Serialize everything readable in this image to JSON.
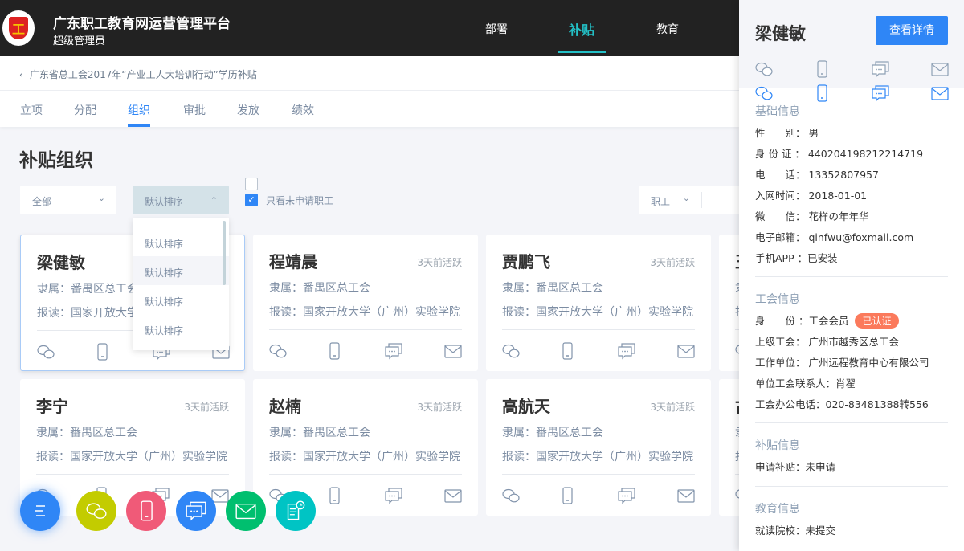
{
  "header": {
    "title": "广东职工教育网运营管理平台",
    "role": "超级管理员",
    "nav": [
      {
        "label": "部署"
      },
      {
        "label": "补贴",
        "active": true
      },
      {
        "label": "教育"
      }
    ],
    "accent": "#23c0c6"
  },
  "breadcrumb": {
    "text": "广东省总工会2017年“产业工人大培训行动”学历补贴"
  },
  "tabs": [
    {
      "label": "立项"
    },
    {
      "label": "分配"
    },
    {
      "label": "组织",
      "active": true
    },
    {
      "label": "审批"
    },
    {
      "label": "发放"
    },
    {
      "label": "绩效"
    }
  ],
  "page_title": "补贴组织",
  "filters": {
    "scope": "全部",
    "sort": "默认排序",
    "only_unapplied_label": "只看未申请职工",
    "only_unapplied": true,
    "type": "职工"
  },
  "sort_options": [
    "默认排序",
    "默认排序",
    "默认排序",
    "默认排序"
  ],
  "cards": [
    {
      "name": "梁健敏",
      "active": "",
      "org": "隶属：番禺区总工会",
      "school": "报读：国家开放大学（广州）实验学院"
    },
    {
      "name": "程靖晨",
      "active": "3天前活跃",
      "org": "隶属：番禺区总工会",
      "school": "报读：国家开放大学（广州）实验学院"
    },
    {
      "name": "贾鹏飞",
      "active": "3天前活跃",
      "org": "隶属：番禺区总工会",
      "school": "报读：国家开放大学（广州）实验学院"
    },
    {
      "name": "王",
      "active": "",
      "org": "隶属",
      "school": "报读"
    },
    {
      "name": "李宁",
      "active": "3天前活跃",
      "org": "隶属：番禺区总工会",
      "school": "报读：国家开放大学（广州）实验学院"
    },
    {
      "name": "赵楠",
      "active": "3天前活跃",
      "org": "隶属：番禺区总工会",
      "school": "报读：国家开放大学（广州）实验学院"
    },
    {
      "name": "高航天",
      "active": "3天前活跃",
      "org": "隶属：番禺区总工会",
      "school": "报读：国家开放大学（广州）实验学院"
    },
    {
      "name": "古",
      "active": "",
      "org": "隶属",
      "school": "报读"
    }
  ],
  "panel": {
    "name": "梁健敏",
    "detail_button": "查看详情",
    "basic_title": "基础信息",
    "basic": [
      "性　　别：  男",
      "身 份 证 ： 440204198212214719",
      "电　　话： 13352807957",
      "入网时间： 2018-01-01",
      "微　　信： 花样の年年华",
      "电子邮箱： qinfwu@foxmail.com",
      "手机APP ：已安装"
    ],
    "union_title": "工会信息",
    "identity": "身　　份 ：工会会员",
    "verified": "已认证",
    "union": [
      "上级工会：  广州市越秀区总工会",
      "工作单位：  广州远程教育中心有限公司",
      "单位工会联系人：肖翟",
      "工会办公电话：020-83481388转556"
    ],
    "subsidy_title": "补贴信息",
    "subsidy": [
      "申请补贴：未申请"
    ],
    "edu_title": "教育信息",
    "edu": [
      "就读院校：未提交"
    ]
  },
  "fab_colors": {
    "menu": "#2f86f6",
    "wechat": "#c3cc00",
    "phone": "#f05a78",
    "message": "#2f86f6",
    "mail": "#00bf6f",
    "record": "#00c4c4"
  }
}
